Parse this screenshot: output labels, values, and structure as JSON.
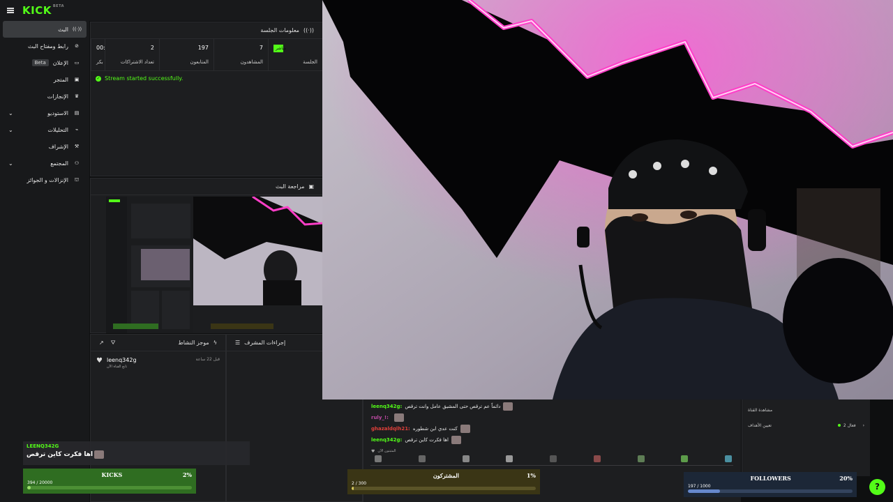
{
  "logo": {
    "text": "KICK",
    "beta": "BETA"
  },
  "sidebar": {
    "items": [
      {
        "label": "البث",
        "icon": "broadcast-icon",
        "glyph": "((·))",
        "active": true
      },
      {
        "label": "رابط ومفتاح البث",
        "icon": "link-icon",
        "glyph": "⊘"
      },
      {
        "label": "الإعلان",
        "icon": "ad-icon",
        "glyph": "▭",
        "badge": "Beta"
      },
      {
        "label": "المتجر",
        "icon": "store-icon",
        "glyph": "▣"
      },
      {
        "label": "الإنجازات",
        "icon": "trophy-icon",
        "glyph": "♛"
      },
      {
        "label": "الاستوديو",
        "icon": "studio-icon",
        "glyph": "▤",
        "expand": true
      },
      {
        "label": "التحليلات",
        "icon": "analytics-icon",
        "glyph": "⌁",
        "expand": true
      },
      {
        "label": "الإشراف",
        "icon": "gavel-icon",
        "glyph": "⚒"
      },
      {
        "label": "المجتمع",
        "icon": "community-icon",
        "glyph": "⚇",
        "expand": true
      },
      {
        "label": "الإنزالات و الجوائز",
        "icon": "drops-icon",
        "glyph": "⛫"
      }
    ]
  },
  "session": {
    "title": "معلومات الجلسة",
    "stats": [
      {
        "value": "مباشر",
        "label": "الجلسة",
        "badge": true
      },
      {
        "value": "7",
        "label": "المشاهدون"
      },
      {
        "value": "197",
        "label": "المتابعون"
      },
      {
        "value": "2",
        "label": "تعداد الاشتراكات"
      },
      {
        "value": "00:",
        "label": "بكر"
      }
    ],
    "status": "Stream started successfully."
  },
  "review": {
    "title": "مراجعة البث"
  },
  "activity": {
    "title": "موجز النشاط",
    "items": [
      {
        "user": "leenq342g",
        "text": "تابع القناة الآن",
        "time": "قبل 22 ساعة"
      }
    ]
  },
  "mod": {
    "title": "إجراءات المشرف"
  },
  "chat": {
    "messages": [
      {
        "user": "leenq342g:",
        "text": "دائماً عم ترقص حتى المشيق عامل وانت ترقص",
        "color": "#53fc18"
      },
      {
        "user": "ruly_!:",
        "text": "",
        "color": "#c04aa5"
      },
      {
        "user": "ghazaldqlh21:",
        "text": "كنت عدي ابن شطوره",
        "color": "#e0403a"
      },
      {
        "user": "leenq342g:",
        "text": "اها فكرت كاين ترقص",
        "color": "#53fc18"
      }
    ],
    "footer": "المثبتون الآن"
  },
  "right_panel": {
    "lines": [
      {
        "text": "مشاهدة القناة"
      },
      {
        "text": "تعيين الأهداف",
        "extra": "فعال 2"
      }
    ]
  },
  "alert": {
    "user": "LEENQ342G",
    "message": "اها فكرت كاين ترقص"
  },
  "goals": {
    "kicks": {
      "title": "KICKS",
      "percent": "2%",
      "count": "394 / 20000",
      "fraction": 0.0197
    },
    "subs": {
      "title": "المشتركون",
      "percent": "1%",
      "count": "2 / 300",
      "fraction": 0.0067
    },
    "followers": {
      "title": "FOLLOWERS",
      "percent": "20%",
      "count": "197 / 1000",
      "fraction": 0.197
    }
  },
  "colors": {
    "accent": "#53fc18",
    "panel": "#1d1e20",
    "background": "#0e0f10"
  }
}
